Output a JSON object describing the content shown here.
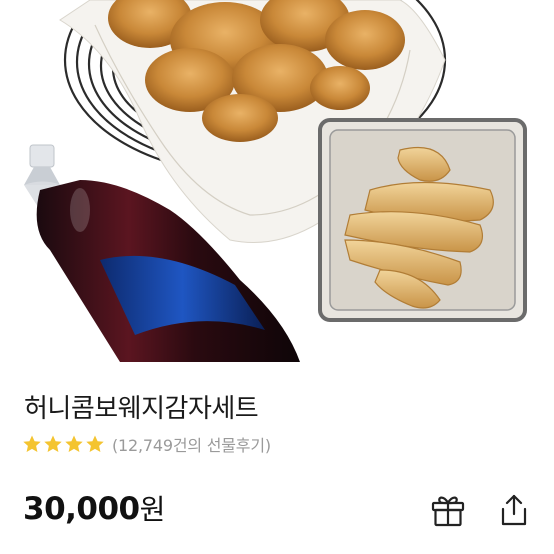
{
  "product": {
    "name": "허니콤보웨지감자세트",
    "rating_stars": 4,
    "review_text": "(12,749건의 선물후기)",
    "price_value": "30,000",
    "price_unit": "원",
    "image_label": "product-photo"
  },
  "actions": {
    "gift_icon": "gift-icon",
    "share_icon": "share-icon"
  },
  "colors": {
    "star": "#F4C430",
    "text_primary": "#1a1a1a",
    "text_secondary": "#9a9a9a"
  }
}
